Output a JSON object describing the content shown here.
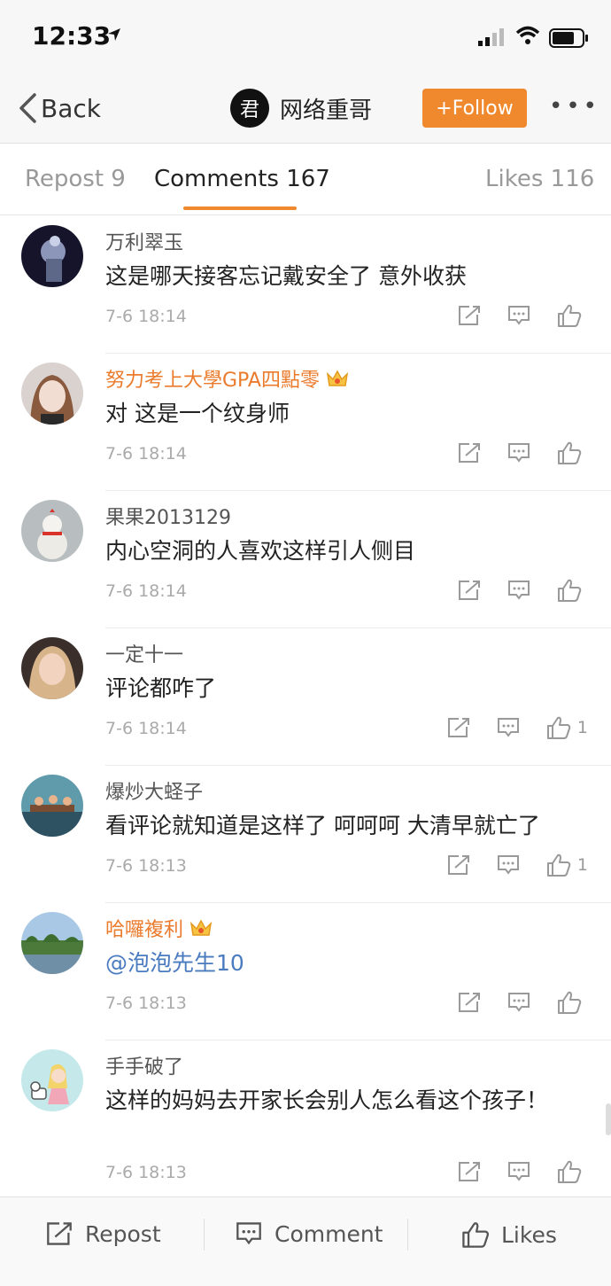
{
  "status": {
    "time": "12:33"
  },
  "nav": {
    "back_label": "Back",
    "avatar_char": "君",
    "profile_name": "网络重哥",
    "follow_label": "+Follow",
    "more": "•••"
  },
  "tabs": {
    "repost": "Repost 9",
    "comments": "Comments 167",
    "likes": "Likes 116"
  },
  "comments": [
    {
      "user": "万利翠玉",
      "vip": false,
      "text": "这是哪天接客忘记戴安全了 意外收获",
      "time": "7-6 18:14",
      "likes": ""
    },
    {
      "user": "努力考上大學GPA四點零",
      "vip": true,
      "text": "对 这是一个纹身师",
      "time": "7-6 18:14",
      "likes": ""
    },
    {
      "user": "果果2013129",
      "vip": false,
      "text": "内心空洞的人喜欢这样引人侧目",
      "time": "7-6 18:14",
      "likes": ""
    },
    {
      "user": "一定十一",
      "vip": false,
      "text": "评论都咋了",
      "time": "7-6 18:14",
      "likes": "1"
    },
    {
      "user": "爆炒大蛏子",
      "vip": false,
      "text": "看评论就知道是这样了 呵呵呵  大清早就亡了",
      "time": "7-6 18:13",
      "likes": "1"
    },
    {
      "user": "哈囉複利",
      "vip": true,
      "text": "@泡泡先生10",
      "time": "7-6 18:13",
      "likes": ""
    },
    {
      "user": "手手破了",
      "vip": false,
      "text": "这样的妈妈去开家长会别人怎么看这个孩子！",
      "time": "7-6 18:13",
      "likes": ""
    }
  ],
  "bottom": {
    "repost": "Repost",
    "comment": "Comment",
    "likes": "Likes"
  },
  "colors": {
    "accent": "#f0892e",
    "mention": "#4a7bbf",
    "vip_name": "#eb7b2c"
  }
}
